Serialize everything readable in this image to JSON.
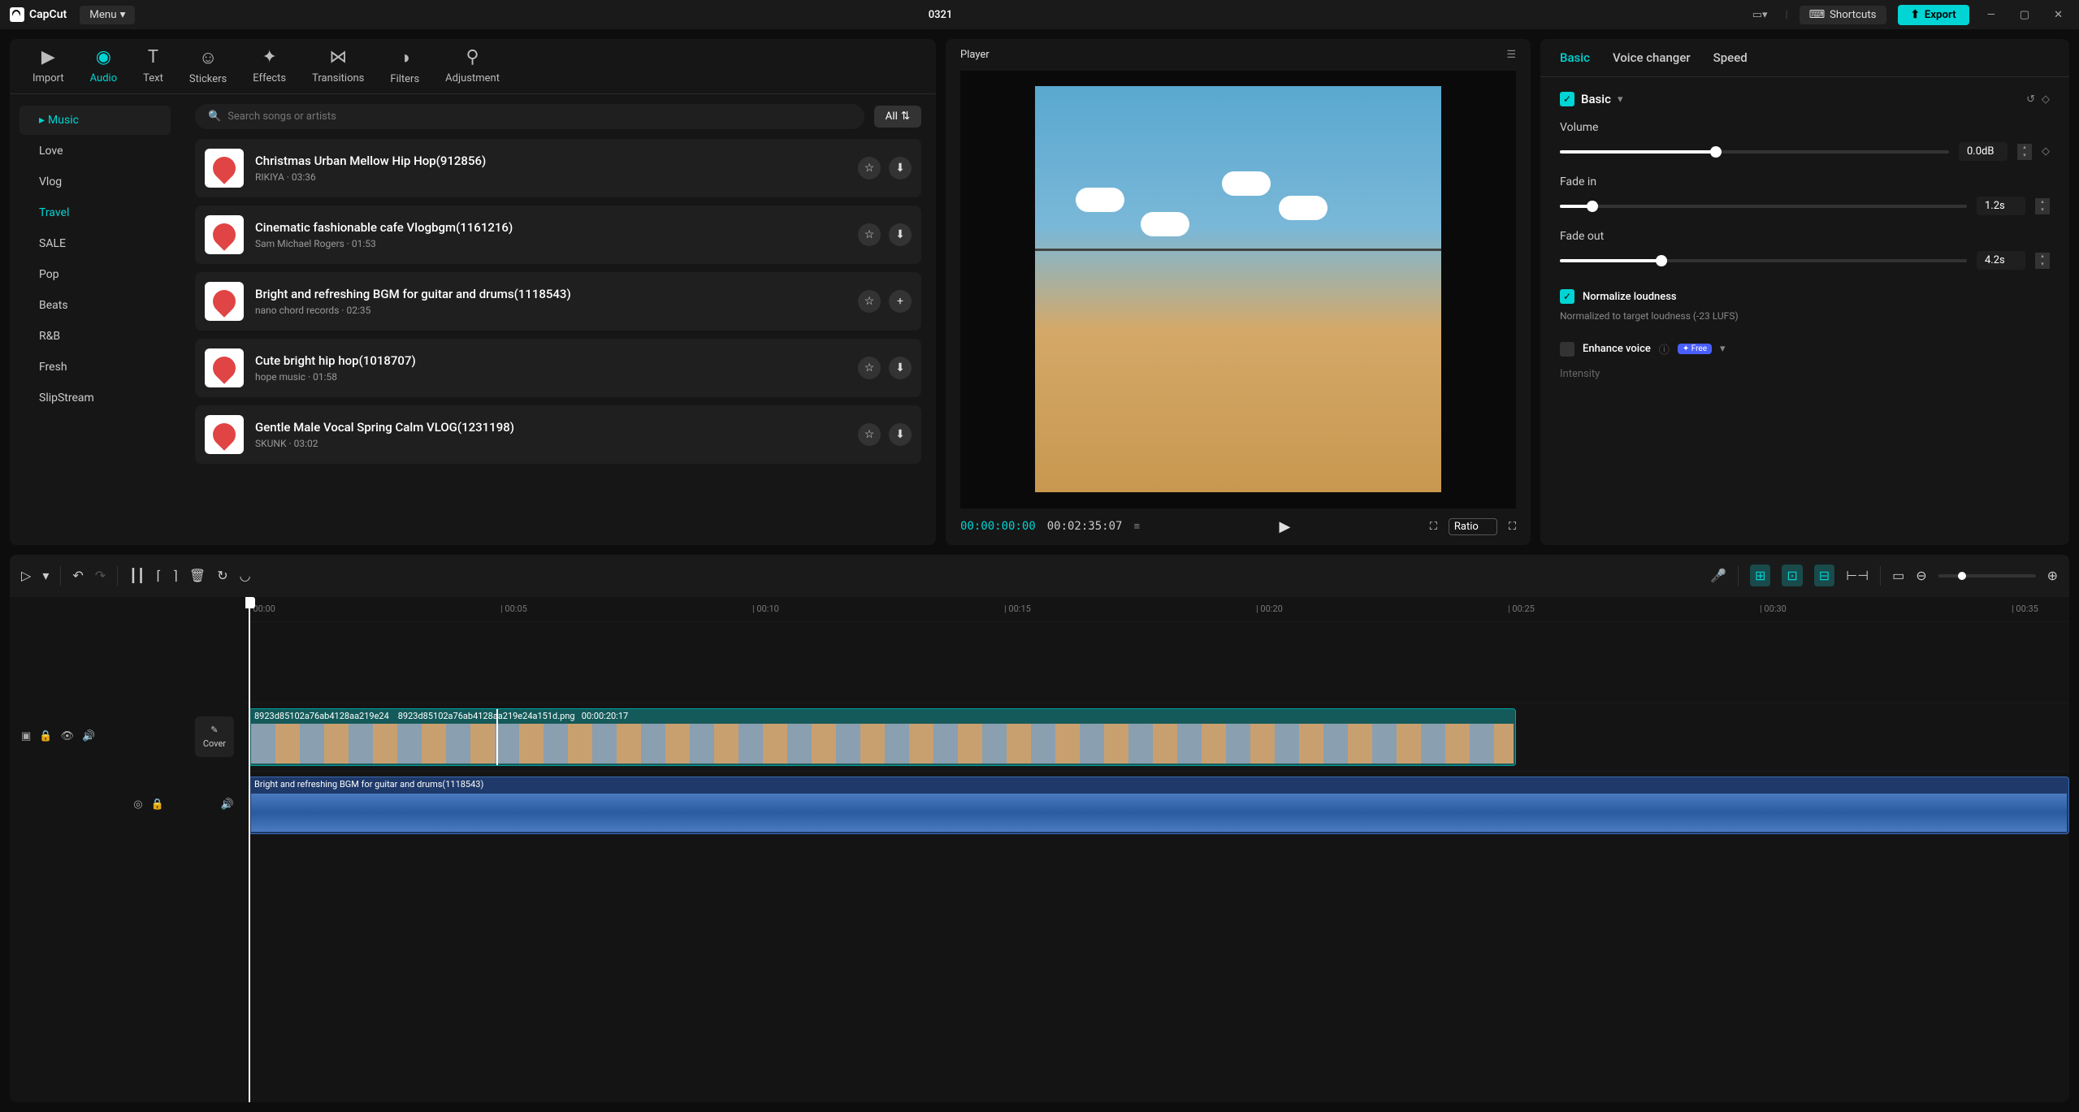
{
  "app": {
    "name": "CapCut",
    "menu": "Menu",
    "title": "0321",
    "shortcuts": "Shortcuts",
    "export": "Export"
  },
  "nav": {
    "import": "Import",
    "audio": "Audio",
    "text": "Text",
    "stickers": "Stickers",
    "effects": "Effects",
    "transitions": "Transitions",
    "filters": "Filters",
    "adjustment": "Adjustment"
  },
  "sidebar": {
    "music": "Music",
    "love": "Love",
    "vlog": "Vlog",
    "travel": "Travel",
    "sale": "SALE",
    "pop": "Pop",
    "beats": "Beats",
    "rnb": "R&B",
    "fresh": "Fresh",
    "slipstream": "SlipStream"
  },
  "search": {
    "placeholder": "Search songs or artists",
    "all": "All"
  },
  "songs": [
    {
      "title": "Christmas Urban Mellow Hip Hop(912856)",
      "meta": "RIKIYA · 03:36",
      "action": "download"
    },
    {
      "title": "Cinematic fashionable cafe Vlogbgm(1161216)",
      "meta": "Sam Michael Rogers · 01:53",
      "action": "download"
    },
    {
      "title": "Bright and refreshing BGM for guitar and drums(1118543)",
      "meta": "nano chord records · 02:35",
      "action": "add"
    },
    {
      "title": "Cute bright hip hop(1018707)",
      "meta": "hope music · 01:58",
      "action": "download"
    },
    {
      "title": "Gentle Male Vocal Spring Calm VLOG(1231198)",
      "meta": "SKUNK · 03:02",
      "action": "download"
    }
  ],
  "player": {
    "label": "Player",
    "current": "00:00:00:00",
    "total": "00:02:35:07",
    "ratio": "Ratio"
  },
  "right": {
    "basic": "Basic",
    "voice": "Voice changer",
    "speed": "Speed",
    "sectionBasic": "Basic",
    "volume": "Volume",
    "volVal": "0.0dB",
    "fadein": "Fade in",
    "fadeinVal": "1.2s",
    "fadeout": "Fade out",
    "fadeoutVal": "4.2s",
    "normalize": "Normalize loudness",
    "normalizeDesc": "Normalized to target loudness (-23 LUFS)",
    "enhance": "Enhance voice",
    "badge": "✦ Free",
    "intensity": "Intensity"
  },
  "ruler": [
    "00:00",
    "00:05",
    "00:10",
    "00:15",
    "00:20",
    "00:25",
    "00:30",
    "00:35"
  ],
  "timeline": {
    "cover": "Cover",
    "videoClip1": "8923d85102a76ab4128aa219e24",
    "videoClip2": "8923d85102a76ab4128aa219e24a151d.png",
    "videoDur": "00:00:20:17",
    "audioClip": "Bright and refreshing BGM for guitar and drums(1118543)"
  }
}
